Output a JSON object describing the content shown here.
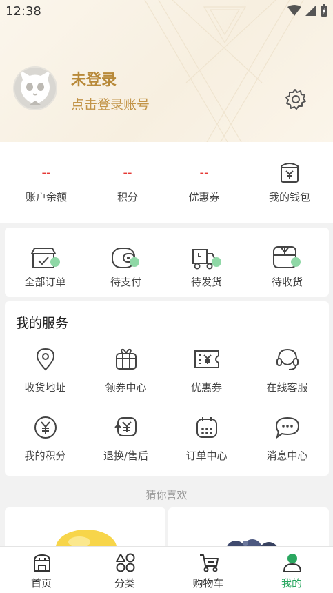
{
  "status_bar": {
    "time": "12:38"
  },
  "profile": {
    "title": "未登录",
    "subtitle": "点击登录账号"
  },
  "stats": [
    {
      "value": "--",
      "label": "账户余额"
    },
    {
      "value": "--",
      "label": "积分"
    },
    {
      "value": "--",
      "label": "优惠券"
    }
  ],
  "wallet": {
    "label": "我的钱包",
    "icon": "wallet-yen-icon"
  },
  "orders": [
    {
      "label": "全部订单",
      "icon": "shop-order-icon"
    },
    {
      "label": "待支付",
      "icon": "wallet-pay-icon"
    },
    {
      "label": "待发货",
      "icon": "delivery-truck-icon"
    },
    {
      "label": "待收货",
      "icon": "package-box-icon"
    }
  ],
  "services": {
    "title": "我的服务",
    "items": [
      {
        "label": "收货地址",
        "icon": "location-pin-icon"
      },
      {
        "label": "领券中心",
        "icon": "gift-box-icon"
      },
      {
        "label": "优惠券",
        "icon": "coupon-ticket-icon"
      },
      {
        "label": "在线客服",
        "icon": "headset-icon"
      },
      {
        "label": "我的积分",
        "icon": "yen-circle-icon"
      },
      {
        "label": "退换/售后",
        "icon": "exchange-yen-icon"
      },
      {
        "label": "订单中心",
        "icon": "calendar-icon"
      },
      {
        "label": "消息中心",
        "icon": "chat-bubble-icon"
      }
    ]
  },
  "guess": {
    "label": "猜你喜欢"
  },
  "tabs": [
    {
      "label": "首页",
      "icon": "home-shop-icon"
    },
    {
      "label": "分类",
      "icon": "category-grid-icon"
    },
    {
      "label": "购物车",
      "icon": "cart-icon"
    },
    {
      "label": "我的",
      "icon": "person-icon",
      "active": true
    }
  ],
  "colors": {
    "accent_green": "#2aa760",
    "gold": "#b88a3a",
    "red": "#e53935"
  }
}
